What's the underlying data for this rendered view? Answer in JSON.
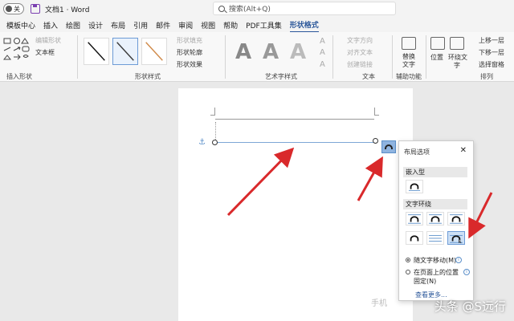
{
  "titlebar": {
    "toggle_label": "关",
    "doc_title": "文档1 · Word",
    "search_placeholder": "搜索(Alt+Q)"
  },
  "tabs": [
    "模板中心",
    "插入",
    "绘图",
    "设计",
    "布局",
    "引用",
    "邮件",
    "审阅",
    "视图",
    "帮助",
    "PDF工具集",
    "形状格式"
  ],
  "active_tab": "形状格式",
  "ribbon": {
    "insert_shapes": {
      "label": "插入形状",
      "edit_shape": "编辑形状",
      "text_box": "文本框"
    },
    "shape_styles": {
      "label": "形状样式",
      "fill": "形状填充",
      "outline": "形状轮廓",
      "effects": "形状效果"
    },
    "wordart": {
      "label": "艺术字样式",
      "fill": "文本填充",
      "outline": "文本轮廓",
      "effects": "文本效果"
    },
    "text": {
      "label": "文本",
      "direction": "文字方向",
      "align": "对齐文本",
      "link": "创建链接"
    },
    "accessibility": {
      "label": "辅助功能",
      "alt_text_line1": "替换",
      "alt_text_line2": "文字"
    },
    "arrange": {
      "label": "排列",
      "position": "位置",
      "wrap_line1": "环绕文",
      "wrap_line2": "字",
      "bring_forward": "上移一层",
      "send_backward": "下移一层",
      "selection_pane": "选择窗格"
    }
  },
  "layout_panel": {
    "title": "布局选项",
    "inline_heading": "嵌入型",
    "wrap_heading": "文字环绕",
    "move_with_text": "随文字移动(M)",
    "fix_position_line1": "在页面上的位置",
    "fix_position_line2": "固定(N)",
    "see_more": "查看更多..."
  },
  "watermark": {
    "main": "头条 @S远行",
    "faint": "手机"
  },
  "colors": {
    "accent": "#2b579a",
    "arrow": "#d9292b",
    "selected_bg": "#cde0f5"
  }
}
